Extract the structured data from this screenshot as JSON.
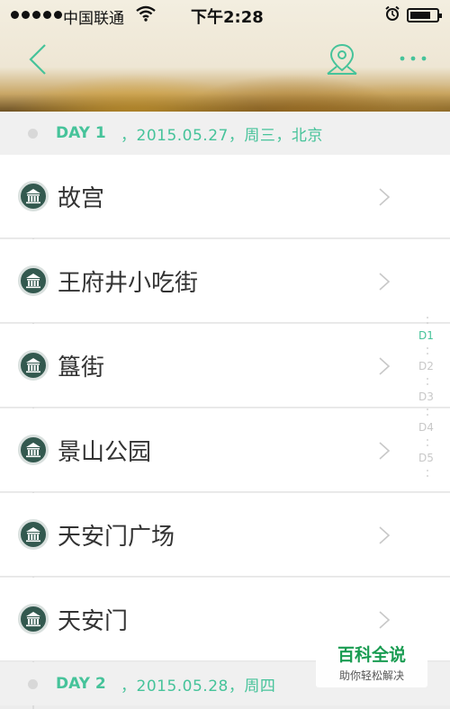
{
  "status_bar": {
    "carrier": "中国联通",
    "time": "下午2:28",
    "battery_level": 0.8,
    "signal_bars": 5
  },
  "nav": {
    "back_icon": "chevron-left-icon",
    "map_icon": "map-pin-icon",
    "more_icon": "more-dots-icon",
    "accent_color": "#46c39a"
  },
  "days": [
    {
      "day": "DAY 1",
      "rest": "，2015.05.27，周三，北京"
    },
    {
      "day": "DAY 2",
      "rest": "，2015.05.28，周四"
    }
  ],
  "places": [
    {
      "name": "故宫",
      "icon": "museum-icon"
    },
    {
      "name": "王府井小吃街",
      "icon": "museum-icon"
    },
    {
      "name": "簋街",
      "icon": "museum-icon"
    },
    {
      "name": "景山公园",
      "icon": "museum-icon"
    },
    {
      "name": "天安门广场",
      "icon": "museum-icon"
    },
    {
      "name": "天安门",
      "icon": "museum-icon"
    }
  ],
  "day_index": [
    "D1",
    "D2",
    "D3",
    "D4",
    "D5"
  ],
  "watermark": {
    "brand": "百科全说",
    "slogan": "助你轻松解决"
  }
}
